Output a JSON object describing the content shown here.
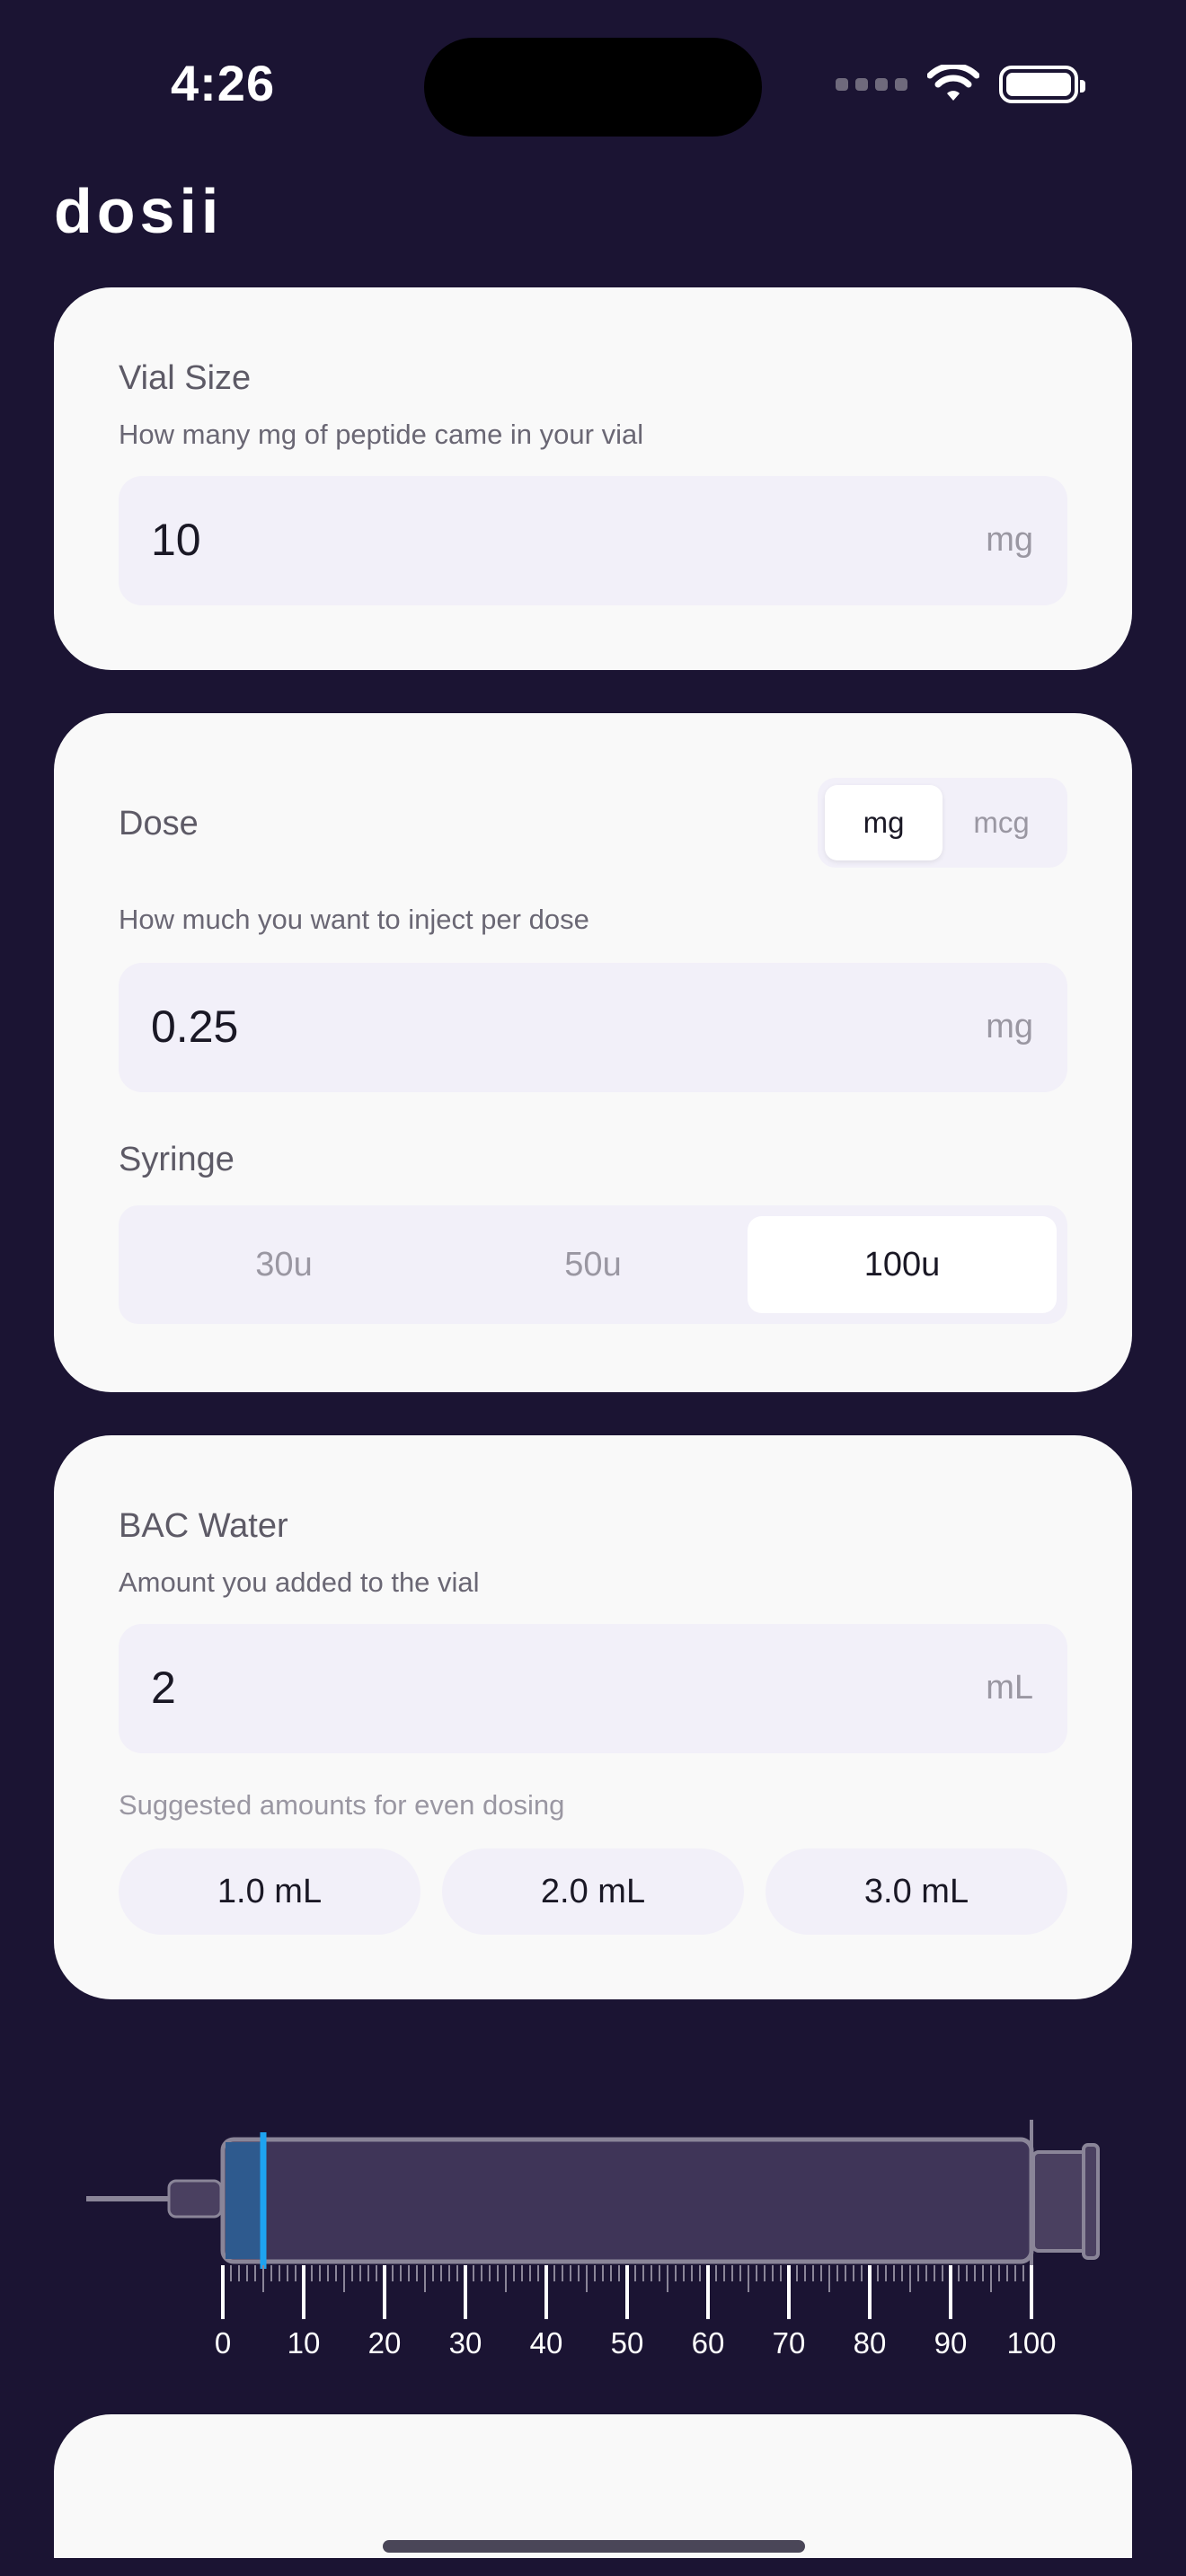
{
  "status": {
    "time": "4:26"
  },
  "app": {
    "title": "dosii"
  },
  "vial": {
    "label": "Vial Size",
    "help": "How many mg of peptide came in your vial",
    "value": "10",
    "unit": "mg"
  },
  "dose": {
    "label": "Dose",
    "help": "How much you want to inject per dose",
    "value": "0.25",
    "unit": "mg",
    "unit_options": [
      "mg",
      "mcg"
    ],
    "unit_selected": "mg"
  },
  "syringe": {
    "label": "Syringe",
    "options": [
      "30u",
      "50u",
      "100u"
    ],
    "selected": "100u"
  },
  "bac": {
    "label": "BAC Water",
    "help": "Amount you added to the vial",
    "value": "2",
    "unit": "mL",
    "suggest_label": "Suggested amounts for even dosing",
    "suggestions": [
      "1.0 mL",
      "2.0 mL",
      "3.0 mL"
    ]
  },
  "syringe_graphic": {
    "scale_max": 100,
    "fill_units": 5,
    "tick_labels": [
      "0",
      "10",
      "20",
      "30",
      "40",
      "50",
      "60",
      "70",
      "80",
      "90",
      "100"
    ],
    "colors": {
      "fill": "#2e5a8e",
      "plunger_line": "#1ea3f0",
      "barrel": "#3f3558"
    }
  }
}
